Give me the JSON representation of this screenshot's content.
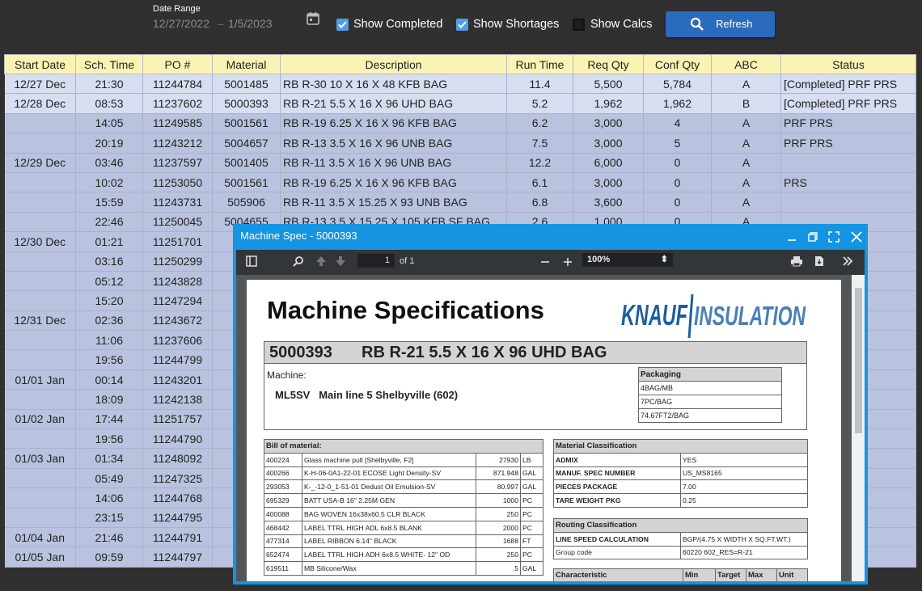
{
  "toolbar": {
    "date_range_label": "Date Range",
    "date_from": "12/27/2022",
    "date_sep": "–",
    "date_to": "1/5/2023",
    "show_completed": {
      "label": "Show Completed",
      "checked": true
    },
    "show_shortages": {
      "label": "Show Shortages",
      "checked": true
    },
    "show_calcs": {
      "label": "Show Calcs",
      "checked": false
    },
    "refresh_label": "Refresh"
  },
  "colors": {
    "accent": "#2b6bbd",
    "header_bg": "#fbf3b4",
    "row_bg": "#b9c3df",
    "completed_row_bg": "#d6deef",
    "modal_border": "#1594e1"
  },
  "grid": {
    "columns": [
      "Start Date",
      "Sch. Time",
      "PO #",
      "Material",
      "Description",
      "Run Time",
      "Req Qty",
      "Conf Qty",
      "ABC",
      "Status"
    ],
    "rows": [
      [
        "12/27 Dec",
        "21:30",
        "11244784",
        "5001485",
        "RB R-30 10 X 16 X 48 KFB BAG",
        "11.4",
        "5,500",
        "5,784",
        "A",
        "[Completed] PRF PRS"
      ],
      [
        "12/28 Dec",
        "08:53",
        "11237602",
        "5000393",
        "RB R-21 5.5 X 16 X 96 UHD BAG",
        "5.2",
        "1,962",
        "1,962",
        "B",
        "[Completed] PRF PRS"
      ],
      [
        "",
        "14:05",
        "11249585",
        "5001561",
        "RB R-19 6.25 X 16 X 96 KFB BAG",
        "6.2",
        "3,000",
        "4",
        "A",
        "PRF PRS"
      ],
      [
        "",
        "20:19",
        "11243212",
        "5004657",
        "RB R-13 3.5 X 16 X 96 UNB BAG",
        "7.5",
        "3,000",
        "5",
        "A",
        "PRF PRS"
      ],
      [
        "12/29 Dec",
        "03:46",
        "11237597",
        "5001405",
        "RB R-11 3.5 X 16 X 96 UNB BAG",
        "12.2",
        "6,000",
        "0",
        "A",
        ""
      ],
      [
        "",
        "10:02",
        "11253050",
        "5001561",
        "RB R-19 6.25 X 16 X 96 KFB BAG",
        "6.1",
        "3,000",
        "0",
        "A",
        "PRS"
      ],
      [
        "",
        "15:59",
        "11243731",
        "505906",
        "RB R-11 3.5 X 15.25 X 93 UNB BAG",
        "6.8",
        "3,600",
        "0",
        "A",
        ""
      ],
      [
        "",
        "22:46",
        "11250045",
        "5004655",
        "RB R-13 3.5 X 15.25 X 105 KFB SF BAG",
        "2.6",
        "1,000",
        "0",
        "A",
        ""
      ],
      [
        "12/30 Dec",
        "01:21",
        "11251701",
        "50",
        "",
        "",
        "",
        "",
        "",
        ""
      ],
      [
        "",
        "03:16",
        "11250299",
        "50",
        "",
        "",
        "",
        "",
        "",
        ""
      ],
      [
        "",
        "05:12",
        "11243828",
        "4",
        "",
        "",
        "",
        "",
        "",
        ""
      ],
      [
        "",
        "15:20",
        "11247294",
        "5",
        "",
        "",
        "",
        "",
        "",
        ""
      ],
      [
        "12/31 Dec",
        "02:36",
        "11243672",
        "5",
        "",
        "",
        "",
        "",
        "",
        ""
      ],
      [
        "",
        "11:06",
        "11237606",
        "4",
        "",
        "",
        "",
        "",
        "",
        ""
      ],
      [
        "",
        "19:56",
        "11244799",
        "50",
        "",
        "",
        "",
        "",
        "",
        ""
      ],
      [
        "01/01 Jan",
        "00:14",
        "11243201",
        "50",
        "",
        "",
        "",
        "",
        "",
        ""
      ],
      [
        "",
        "18:09",
        "11242138",
        "50",
        "",
        "",
        "",
        "",
        "",
        ""
      ],
      [
        "01/02 Jan",
        "17:44",
        "11251757",
        "50",
        "",
        "",
        "",
        "",
        "",
        ""
      ],
      [
        "",
        "19:56",
        "11244790",
        "50",
        "",
        "",
        "",
        "",
        "",
        ""
      ],
      [
        "01/03 Jan",
        "01:34",
        "11248092",
        "5",
        "",
        "",
        "",
        "",
        "",
        ""
      ],
      [
        "",
        "05:49",
        "11247325",
        "50",
        "",
        "",
        "",
        "",
        "",
        ""
      ],
      [
        "",
        "14:06",
        "11244768",
        "5",
        "",
        "",
        "",
        "",
        "",
        ""
      ],
      [
        "",
        "23:15",
        "11244795",
        "5",
        "",
        "",
        "",
        "",
        "",
        ""
      ],
      [
        "01/04 Jan",
        "21:46",
        "11244791",
        "5",
        "",
        "",
        "",
        "",
        "",
        ""
      ],
      [
        "01/05 Jan",
        "09:59",
        "11244797",
        "4",
        "",
        "",
        "",
        "",
        "",
        ""
      ]
    ],
    "completed_rows": [
      0,
      1
    ]
  },
  "modal": {
    "title": "Machine Spec - 5000393",
    "pdf_toolbar": {
      "page": "1",
      "of": "of 1",
      "zoom": "100%"
    },
    "doc": {
      "title": "Machine Specifications",
      "logo_text_a": "KNAUF",
      "logo_text_b": "INSULATION",
      "material_code": "5000393",
      "material_desc": "RB R-21 5.5 X 16 X 96 UHD BAG",
      "machine_label": "Machine:",
      "machine_code": "ML5SV",
      "machine_desc": "Main line 5 Shelbyville (602)",
      "packaging": {
        "header": "Packaging",
        "rows": [
          "4BAG/MB",
          "7PC/BAG",
          "74.67FT2/BAG"
        ]
      },
      "bom": {
        "header": "Bill of material:",
        "rows": [
          [
            "400224",
            "Glass machine pull [Shelbyville, F2]",
            "27930",
            "LB"
          ],
          [
            "400266",
            "K-H-06-0A1-22-01 ECOSE Light Density-SV",
            "871.948",
            "GAL"
          ],
          [
            "293053",
            "K-_-12-0_1-51-01 Dedust Oil Emulsion-SV",
            "80.997",
            "GAL"
          ],
          [
            "695329",
            "BATT USA-B 16\" 2.25M GEN",
            "1000",
            "PC"
          ],
          [
            "400088",
            "BAG WOVEN 16x38x60.5 CLR BLACK",
            "250",
            "PC"
          ],
          [
            "468442",
            "LABEL TTRL HIGH ADL 6x8.5 BLANK",
            "2000",
            "PC"
          ],
          [
            "477314",
            "LABEL RIBBON 6.14\" BLACK",
            "1688",
            "FT"
          ],
          [
            "652474",
            "LABEL TTRL HIGH ADH 6x8.5 WHITE- 12\" OD",
            "250",
            "PC"
          ],
          [
            "619511",
            "MB Silicone/Wax",
            ".5",
            "GAL"
          ]
        ]
      },
      "material_class": {
        "header": "Material Classification",
        "rows": [
          [
            "ADMIX",
            "YES"
          ],
          [
            "MANUF. SPEC NUMBER",
            "US_MS8165"
          ],
          [
            "PIECES PACKAGE",
            "7.00"
          ],
          [
            "TARE WEIGHT PKG",
            "0.25"
          ]
        ]
      },
      "routing_class": {
        "header": "Routing Classification",
        "rows": [
          [
            "LINE SPEED CALCULATION",
            "BGP/(4.75 X WIDTH X SQ.FT.WT.)"
          ],
          [
            "Group code",
            "60220 602_RES=R-21"
          ]
        ]
      },
      "characteristic": {
        "header": [
          "Characteristic",
          "Min",
          "Target",
          "Max",
          "Unit"
        ]
      }
    }
  }
}
